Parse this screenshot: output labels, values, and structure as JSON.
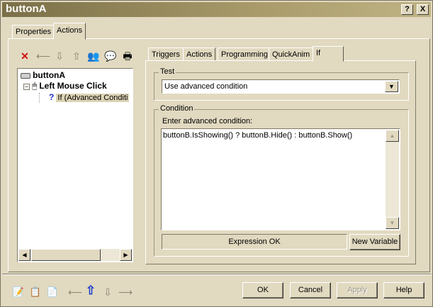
{
  "window": {
    "title": "buttonA"
  },
  "titlebar": {
    "help_label": "?",
    "close_label": "X"
  },
  "outer_tabs": [
    {
      "label": "Properties"
    },
    {
      "label": "Actions"
    }
  ],
  "toolbar_icons": [
    "delete-icon",
    "minus-icon",
    "move-down-icon",
    "move-up-icon",
    "users-icon",
    "comment-icon",
    "print-icon"
  ],
  "tree": {
    "root": "buttonA",
    "event": "Left Mouse Click",
    "action": "If (Advanced Conditi"
  },
  "inner_tabs": [
    {
      "label": "Triggers"
    },
    {
      "label": "Actions"
    },
    {
      "label": "Programming"
    },
    {
      "label": "QuickAnim"
    },
    {
      "label": "If"
    }
  ],
  "test": {
    "group_label": "Test",
    "selected": "Use advanced condition"
  },
  "condition": {
    "group_label": "Condition",
    "prompt": "Enter advanced condition:",
    "expression": "buttonB.IsShowing() ? buttonB.Hide() : buttonB.Show()",
    "status": "Expression OK",
    "new_variable_label": "New Variable"
  },
  "buttons": {
    "ok": "OK",
    "cancel": "Cancel",
    "apply": "Apply",
    "help": "Help"
  },
  "colors": {
    "title_start": "#7a6f48",
    "title_end": "#c0b385",
    "face": "#e1d9c0",
    "selection": "#dcd4b6",
    "arrow_blue": "#1a3ccc"
  }
}
